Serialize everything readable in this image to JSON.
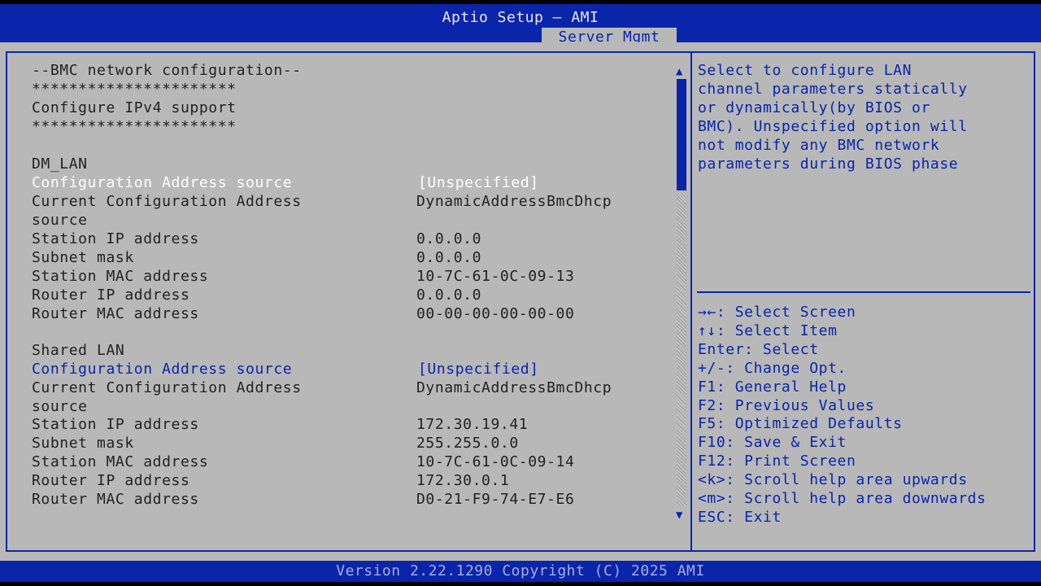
{
  "app_title": "Aptio Setup – AMI",
  "active_tab": "Server Mgmt",
  "section_header": "--BMC network configuration--",
  "stars": "**********************",
  "ipv4_label": "Configure IPv4 support",
  "dm_lan": {
    "title": "DM_LAN",
    "config_source_label": "Configuration Address source",
    "config_source_value": "[Unspecified]",
    "current_config_label_1": "Current Configuration Address",
    "current_config_label_2": "source",
    "current_config_value": "DynamicAddressBmcDhcp",
    "rows": [
      {
        "label": "Station IP address",
        "value": "0.0.0.0"
      },
      {
        "label": "Subnet mask",
        "value": "0.0.0.0"
      },
      {
        "label": "Station MAC address",
        "value": "10-7C-61-0C-09-13"
      },
      {
        "label": "Router IP address",
        "value": "0.0.0.0"
      },
      {
        "label": "Router MAC address",
        "value": "00-00-00-00-00-00"
      }
    ]
  },
  "shared_lan": {
    "title": "Shared LAN",
    "config_source_label": "Configuration Address source",
    "config_source_value": "[Unspecified]",
    "current_config_label_1": "Current Configuration Address",
    "current_config_label_2": "source",
    "current_config_value": "DynamicAddressBmcDhcp",
    "rows": [
      {
        "label": "Station IP address",
        "value": "172.30.19.41"
      },
      {
        "label": "Subnet mask",
        "value": "255.255.0.0"
      },
      {
        "label": "Station MAC address",
        "value": "10-7C-61-0C-09-14"
      },
      {
        "label": "Router IP address",
        "value": "172.30.0.1"
      },
      {
        "label": "Router MAC address",
        "value": "D0-21-F9-74-E7-E6"
      }
    ]
  },
  "help_lines": [
    "Select to configure LAN",
    "channel parameters statically",
    "or dynamically(by BIOS or",
    "BMC). Unspecified option will",
    "not modify any BMC network",
    "parameters during BIOS phase"
  ],
  "key_help": [
    "→←: Select Screen",
    "↑↓: Select Item",
    "Enter: Select",
    "+/-: Change Opt.",
    "F1: General Help",
    "F2: Previous Values",
    "F5: Optimized Defaults",
    "F10: Save & Exit",
    "F12: Print Screen",
    "<k>: Scroll help area upwards",
    "<m>: Scroll help area downwards",
    "ESC: Exit"
  ],
  "scroll_position": 0.0,
  "footer": "Version 2.22.1290 Copyright (C) 2025 AMI",
  "colors": {
    "accent": "#0a24aa",
    "background": "#b8b8b8",
    "selected_text": "#ffffff"
  }
}
